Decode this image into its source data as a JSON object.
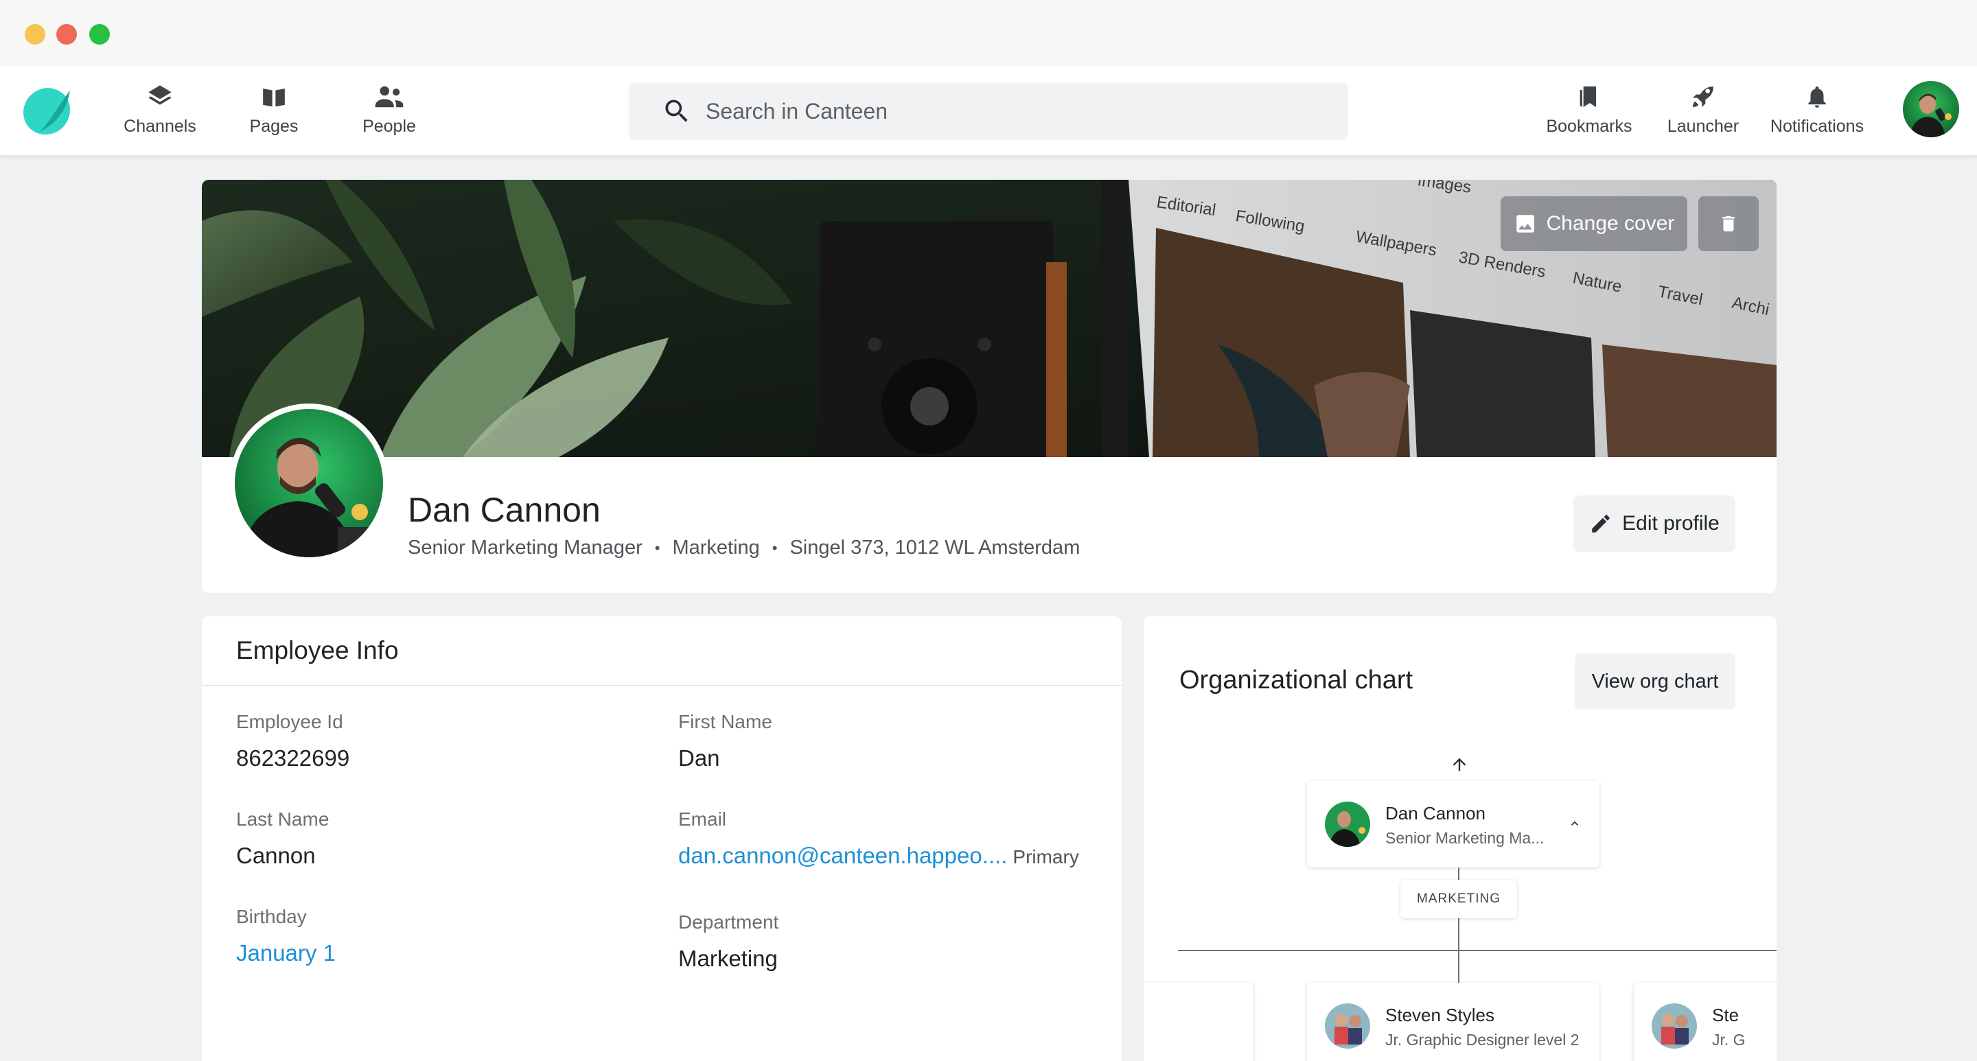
{
  "nav": {
    "items": [
      {
        "label": "Channels",
        "icon": "layers-icon"
      },
      {
        "label": "Pages",
        "icon": "book-icon"
      },
      {
        "label": "People",
        "icon": "people-icon"
      }
    ],
    "search_placeholder": "Search in Canteen",
    "right_items": [
      {
        "label": "Bookmarks",
        "icon": "bookmark-icon"
      },
      {
        "label": "Launcher",
        "icon": "rocket-icon"
      },
      {
        "label": "Notifications",
        "icon": "bell-icon"
      }
    ]
  },
  "profile": {
    "cover_button": "Change cover",
    "name": "Dan Cannon",
    "title": "Senior Marketing Manager",
    "department": "Marketing",
    "location": "Singel 373, 1012 WL Amsterdam",
    "edit_button": "Edit profile",
    "cover_tabs": [
      "Editorial",
      "Following",
      "Wallpapers",
      "3D Renders",
      "Nature",
      "Travel",
      "Archi",
      "Images"
    ]
  },
  "employee_info": {
    "title": "Employee Info",
    "fields": {
      "employee_id": {
        "label": "Employee Id",
        "value": "862322699"
      },
      "first_name": {
        "label": "First Name",
        "value": "Dan"
      },
      "last_name": {
        "label": "Last Name",
        "value": "Cannon"
      },
      "email": {
        "label": "Email",
        "value": "dan.cannon@canteen.happeo....",
        "badge": "Primary"
      },
      "birthday": {
        "label": "Birthday",
        "value": "January 1"
      },
      "department": {
        "label": "Department",
        "value": "Marketing"
      }
    }
  },
  "org_chart": {
    "title": "Organizational chart",
    "view_button": "View org chart",
    "current": {
      "name": "Dan Cannon",
      "role": "Senior Marketing Ma..."
    },
    "department_tag": "MARKETING",
    "reports": [
      {
        "name": "Steven Styles",
        "role": "Jr. Graphic Designer level 2"
      },
      {
        "name": "Ste",
        "role": "Jr. G"
      }
    ]
  },
  "colors": {
    "accent": "#1e8fd6",
    "logo": "#22c7b8",
    "background": "#f0f1f2"
  }
}
